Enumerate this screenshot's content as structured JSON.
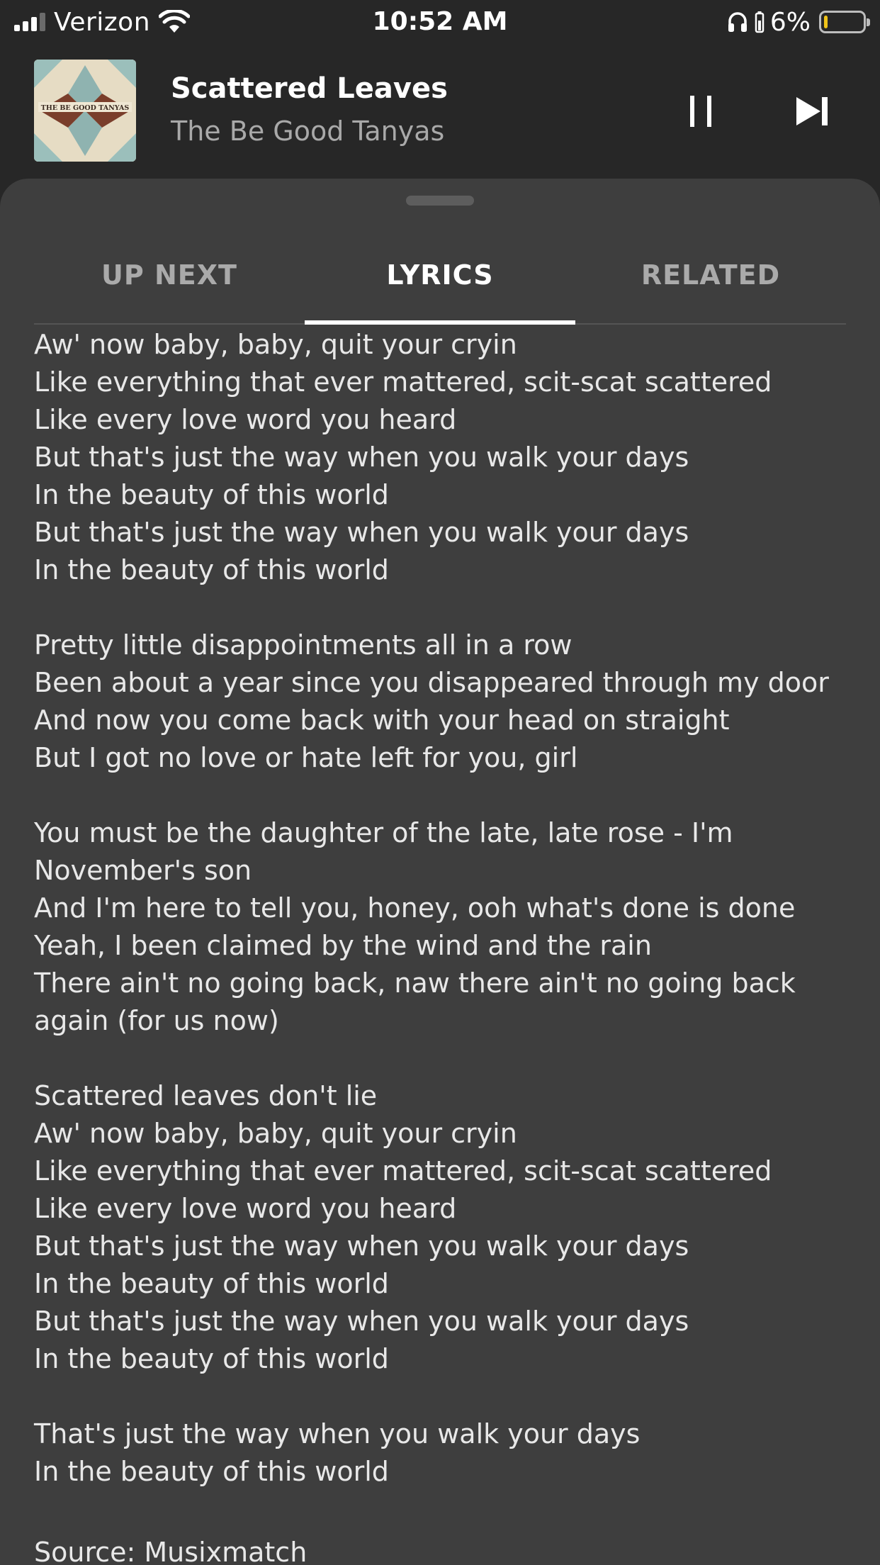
{
  "status_bar": {
    "carrier": "Verizon",
    "time": "10:52 AM",
    "battery_percent": "6%",
    "battery_level": 0.06,
    "battery_color": "#f0c419"
  },
  "now_playing": {
    "title": "Scattered Leaves",
    "artist": "The Be Good Tanyas",
    "album_art_text": "THE BE GOOD TANYAS",
    "pause_icon": "pause-icon",
    "next_icon": "skip-next-icon"
  },
  "tabs": [
    {
      "label": "UP NEXT",
      "active": false
    },
    {
      "label": "LYRICS",
      "active": true
    },
    {
      "label": "RELATED",
      "active": false
    }
  ],
  "lyrics": {
    "lines": [
      "Aw' now baby, baby, quit your cryin",
      "Like everything that ever mattered, scit-scat scattered",
      "Like every love word you heard",
      "But that's just the way when you walk your days",
      "In the beauty of this world",
      "But that's just the way when you walk your days",
      "In the beauty of this world",
      "",
      "Pretty little disappointments all in a row",
      "Been about a year since you disappeared through my door",
      "And now you come back with your head on straight",
      "But I got no love or hate left for you, girl",
      "",
      "You must be the daughter of the late, late rose - I'm",
      "November's son",
      "And I'm here to tell you, honey, ooh what's done is done",
      "Yeah, I been claimed by the wind and the rain",
      "There ain't no going back, naw there ain't no going back",
      "again (for us now)",
      "",
      "Scattered leaves don't lie",
      "Aw' now baby, baby, quit your cryin",
      "Like everything that ever mattered, scit-scat scattered",
      "Like every love word you heard",
      "But that's just the way when you walk your days",
      "In the beauty of this world",
      "But that's just the way when you walk your days",
      "In the beauty of this world",
      "",
      "That's just the way when you walk your days",
      "In the beauty of this world"
    ],
    "source": "Source: Musixmatch"
  }
}
